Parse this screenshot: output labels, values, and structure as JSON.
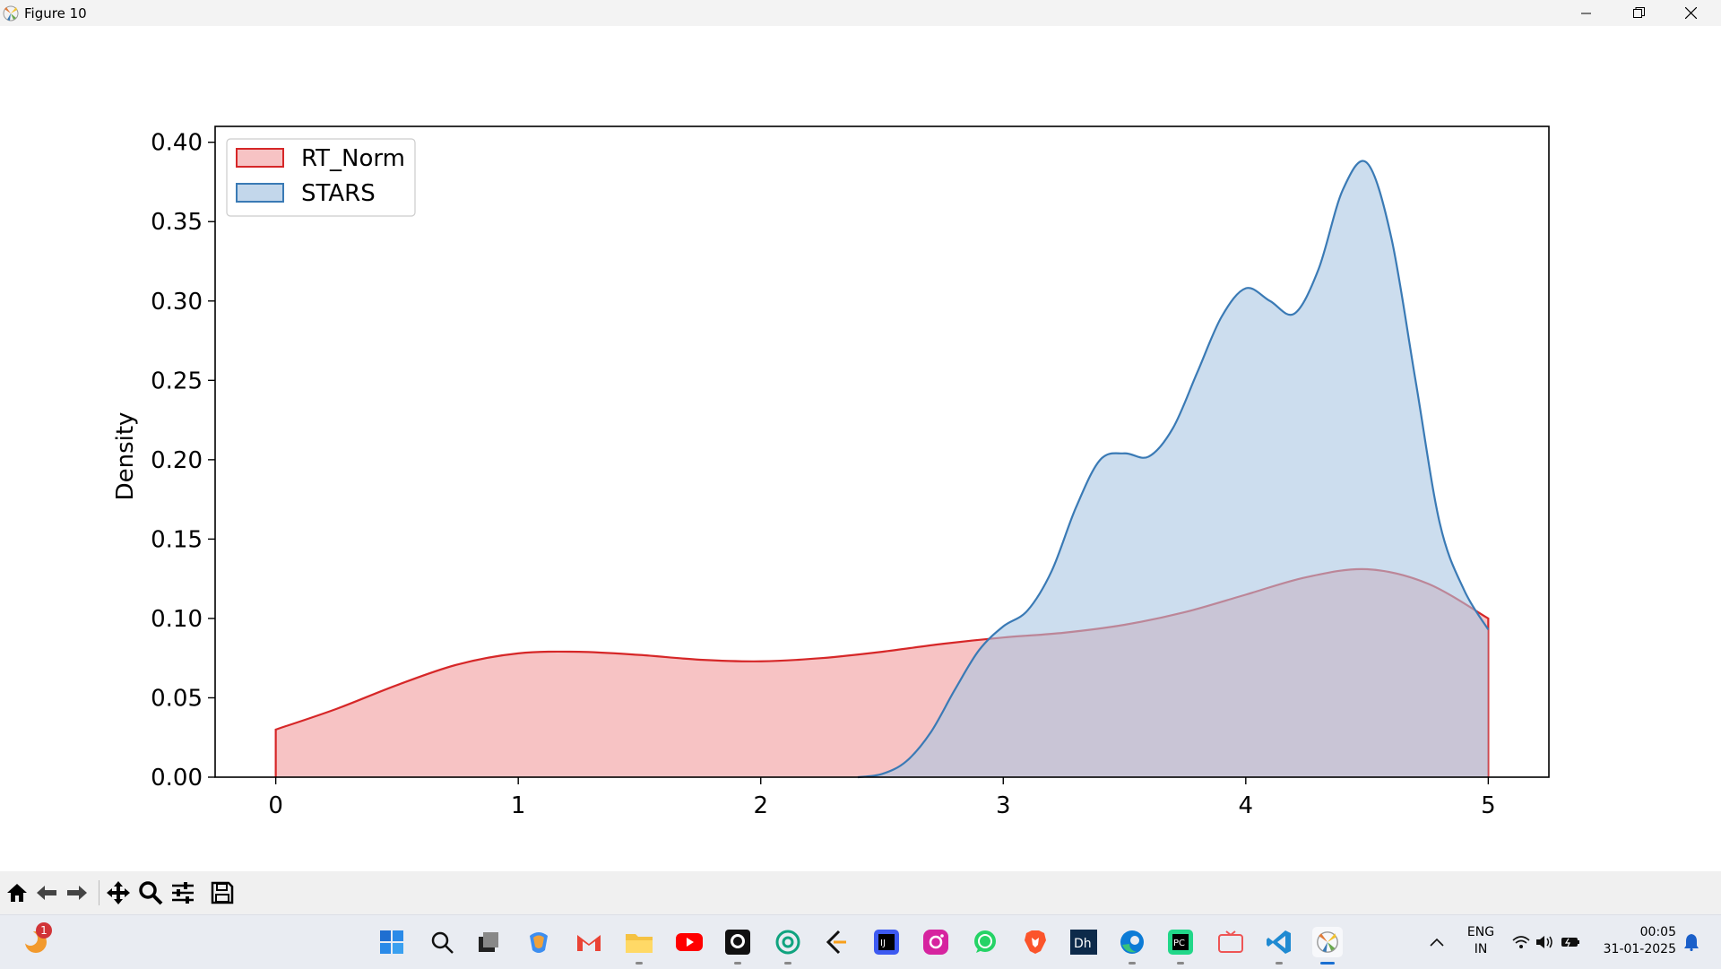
{
  "window": {
    "title": "Figure 10"
  },
  "chart_data": {
    "type": "area",
    "title": "",
    "xlabel": "",
    "ylabel": "Density",
    "xlim": [
      -0.25,
      5.25
    ],
    "ylim": [
      0,
      0.41
    ],
    "xticks": [
      0,
      1,
      2,
      3,
      4,
      5
    ],
    "yticks": [
      "0.00",
      "0.05",
      "0.10",
      "0.15",
      "0.20",
      "0.25",
      "0.30",
      "0.35",
      "0.40"
    ],
    "legend_position": "top-left",
    "series": [
      {
        "name": "RT_Norm",
        "color": "#d62728",
        "fill": "#f4a9ab",
        "x": [
          0,
          0.25,
          0.5,
          0.75,
          1.0,
          1.25,
          1.5,
          1.75,
          2.0,
          2.25,
          2.5,
          2.75,
          3.0,
          3.25,
          3.5,
          3.75,
          4.0,
          4.25,
          4.5,
          4.75,
          5.0
        ],
        "y": [
          0.03,
          0.043,
          0.058,
          0.071,
          0.078,
          0.079,
          0.077,
          0.074,
          0.073,
          0.075,
          0.079,
          0.084,
          0.088,
          0.091,
          0.096,
          0.104,
          0.115,
          0.126,
          0.131,
          0.122,
          0.1
        ]
      },
      {
        "name": "STARS",
        "color": "#3a7ab5",
        "fill": "#aac6e2",
        "x": [
          2.4,
          2.5,
          2.6,
          2.7,
          2.8,
          2.9,
          3.0,
          3.1,
          3.2,
          3.3,
          3.4,
          3.5,
          3.6,
          3.7,
          3.8,
          3.9,
          4.0,
          4.1,
          4.2,
          4.3,
          4.4,
          4.5,
          4.6,
          4.7,
          4.8,
          4.9,
          5.0
        ],
        "y": [
          0.0,
          0.002,
          0.01,
          0.028,
          0.055,
          0.08,
          0.095,
          0.105,
          0.13,
          0.17,
          0.2,
          0.204,
          0.202,
          0.22,
          0.255,
          0.29,
          0.308,
          0.3,
          0.292,
          0.32,
          0.37,
          0.387,
          0.34,
          0.25,
          0.16,
          0.118,
          0.093
        ]
      }
    ]
  },
  "toolbar": {
    "buttons": [
      "home-icon",
      "back-icon",
      "forward-icon",
      "pan-icon",
      "zoom-icon",
      "configure-icon",
      "save-icon"
    ]
  },
  "taskbar": {
    "notification_badge": "1",
    "language_line1": "ENG",
    "language_line2": "IN",
    "time": "00:05",
    "date": "31-01-2025"
  }
}
